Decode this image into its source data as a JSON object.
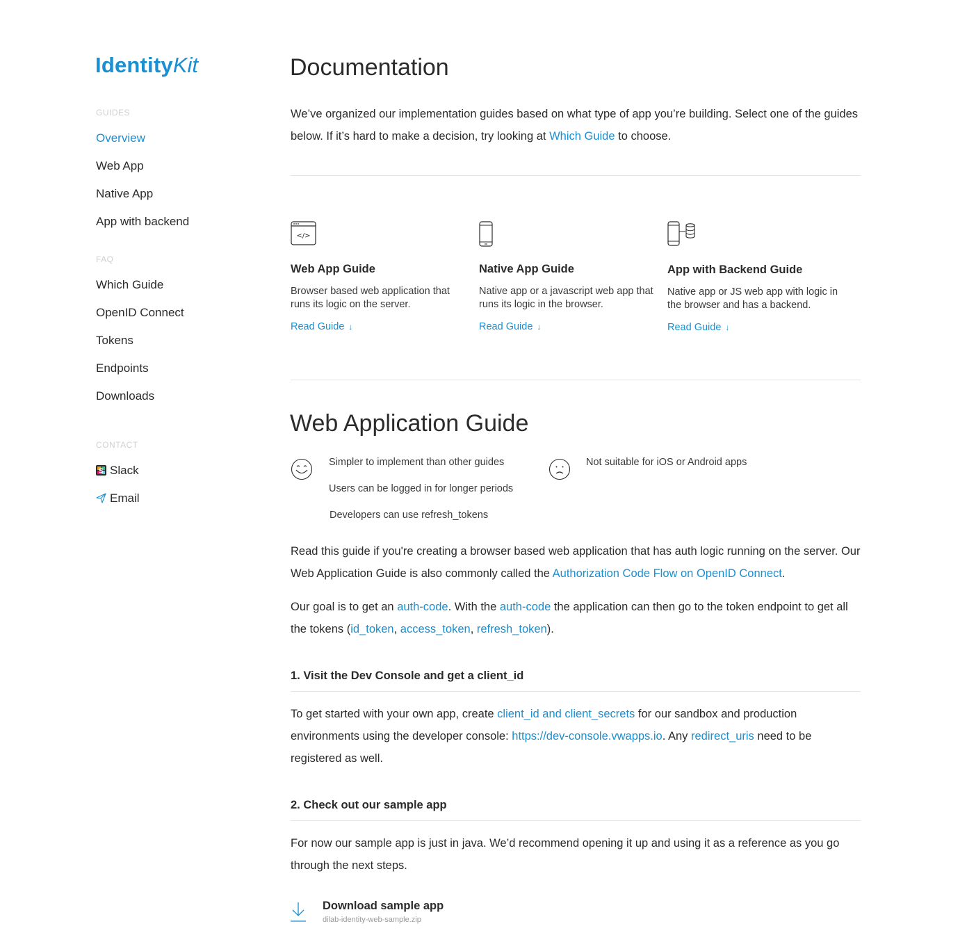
{
  "logo": {
    "bold": "Identity",
    "italic": "Kit"
  },
  "sidebar": {
    "guides_label": "GUIDES",
    "guides": [
      "Overview",
      "Web App",
      "Native App",
      "App with backend"
    ],
    "faq_label": "FAQ",
    "faq": [
      "Which Guide",
      "OpenID Connect",
      "Tokens",
      "Endpoints",
      "Downloads"
    ],
    "contact_label": "CONTACT",
    "contact": [
      {
        "label": "Slack",
        "icon": "slack-icon"
      },
      {
        "label": "Email",
        "icon": "paper-plane-icon"
      }
    ]
  },
  "main": {
    "title": "Documentation",
    "intro": {
      "before": "We’ve organized our implementation guides based on what type of app you’re building. Select one of the guides below. If it’s hard to make a decision, try looking at ",
      "link": "Which Guide",
      "after": " to choose."
    },
    "cards": [
      {
        "icon": "browser-code-icon",
        "title": "Web App Guide",
        "desc": "Browser based web application that runs its logic on the server.",
        "link": "Read Guide",
        "arrow": "↓"
      },
      {
        "icon": "mobile-phone-icon",
        "title": "Native App Guide",
        "desc": "Native app or a javascript web app that runs its logic in the browser.",
        "link": "Read Guide",
        "arrow": "↓"
      },
      {
        "icon": "phone-database-icon",
        "title": "App with Backend Guide",
        "desc": "Native app or JS web app with logic in the browser and has a backend.",
        "link": "Read Guide",
        "arrow": "↓"
      }
    ],
    "web_guide": {
      "title": "Web Application Guide",
      "pros": [
        "Simpler to implement than other guides",
        "Users can be logged in for longer periods",
        "Developers can use refresh_tokens"
      ],
      "cons": [
        "Not suitable for iOS or Android apps"
      ],
      "p1": {
        "before": "Read this guide if you're creating a browser based web application that has auth logic running on the server. Our Web Application Guide is also commonly called the ",
        "link": "Authorization Code Flow on OpenID Connect",
        "after": "."
      },
      "p2": {
        "t1": "Our goal is to get an ",
        "l1": "auth-code",
        "t2": ". With the ",
        "l2": "auth-code",
        "t3": " the application can then go to the token endpoint to get all the tokens (",
        "l3": "id_token",
        "t4": ", ",
        "l4": "access_token",
        "t5": ", ",
        "l5": "refresh_token",
        "t6": ")."
      },
      "step1": {
        "title": "1. Visit the Dev Console and get a client_id",
        "t1": "To get started with your own app, create ",
        "l1": "client_id and client_secrets",
        "t2": " for our sandbox and production environments using the developer console: ",
        "l2": "https://dev-console.vwapps.io",
        "t3": ". Any ",
        "l3": "redirect_uris",
        "t4": " need to be registered as well."
      },
      "step2": {
        "title": "2. Check out our sample app",
        "text": "For now our sample app is just in java. We’d recommend opening it up and using it as a reference as you go through the next steps."
      },
      "download": {
        "title": "Download sample app",
        "file": "dilab-identity-web-sample.zip",
        "icon": "download-icon"
      }
    }
  },
  "colors": {
    "accent": "#1a8fd1",
    "text": "#2b2b2b",
    "muted": "#d0d0d0",
    "rule": "#e2e2e2"
  }
}
